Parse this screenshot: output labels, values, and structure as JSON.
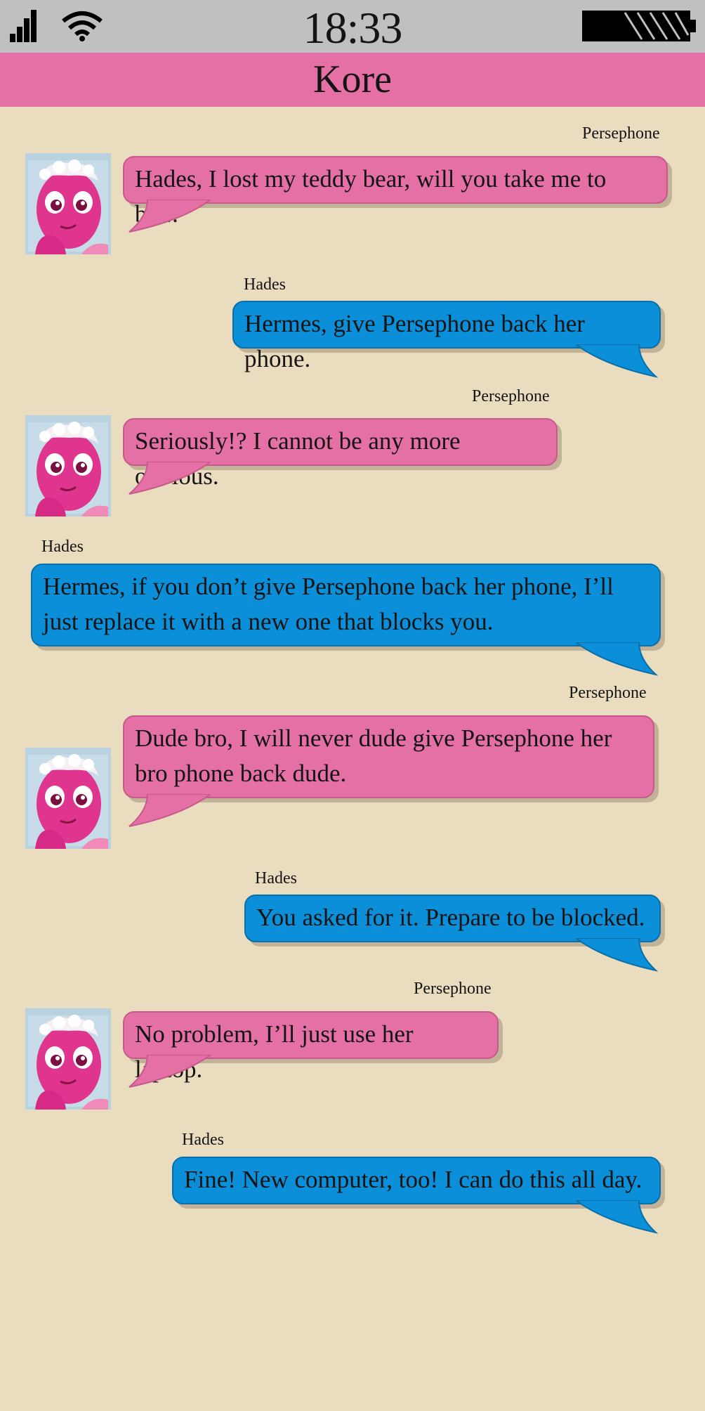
{
  "status_bar": {
    "time": "18:33",
    "icons": [
      "signal-icon",
      "wifi-icon",
      "battery-icon"
    ]
  },
  "header": {
    "title": "Kore"
  },
  "colors": {
    "background": "#eadcbf",
    "status_bar": "#c0c0c0",
    "pink_bubble": "#e570a5",
    "blue_bubble": "#0a8fd8"
  },
  "messages": [
    {
      "sender": "Persephone",
      "text": "Hades, I lost my teddy bear, will you take me to bed?"
    },
    {
      "sender": "Hades",
      "text": "Hermes, give Persephone back her phone."
    },
    {
      "sender": "Persephone",
      "text": "Seriously!? I cannot be any more obvious."
    },
    {
      "sender": "Hades",
      "text": "Hermes, if you don’t give Persephone back her phone, I’ll just replace it with a new one that blocks you."
    },
    {
      "sender": "Persephone",
      "text": "Dude bro, I will never dude give Persephone her bro phone back dude."
    },
    {
      "sender": "Hades",
      "text": "You asked for it. Prepare to be blocked."
    },
    {
      "sender": "Persephone",
      "text": "No problem, I’ll just use her laptop."
    },
    {
      "sender": "Hades",
      "text": "Fine! New computer, too! I can do this all day."
    }
  ]
}
